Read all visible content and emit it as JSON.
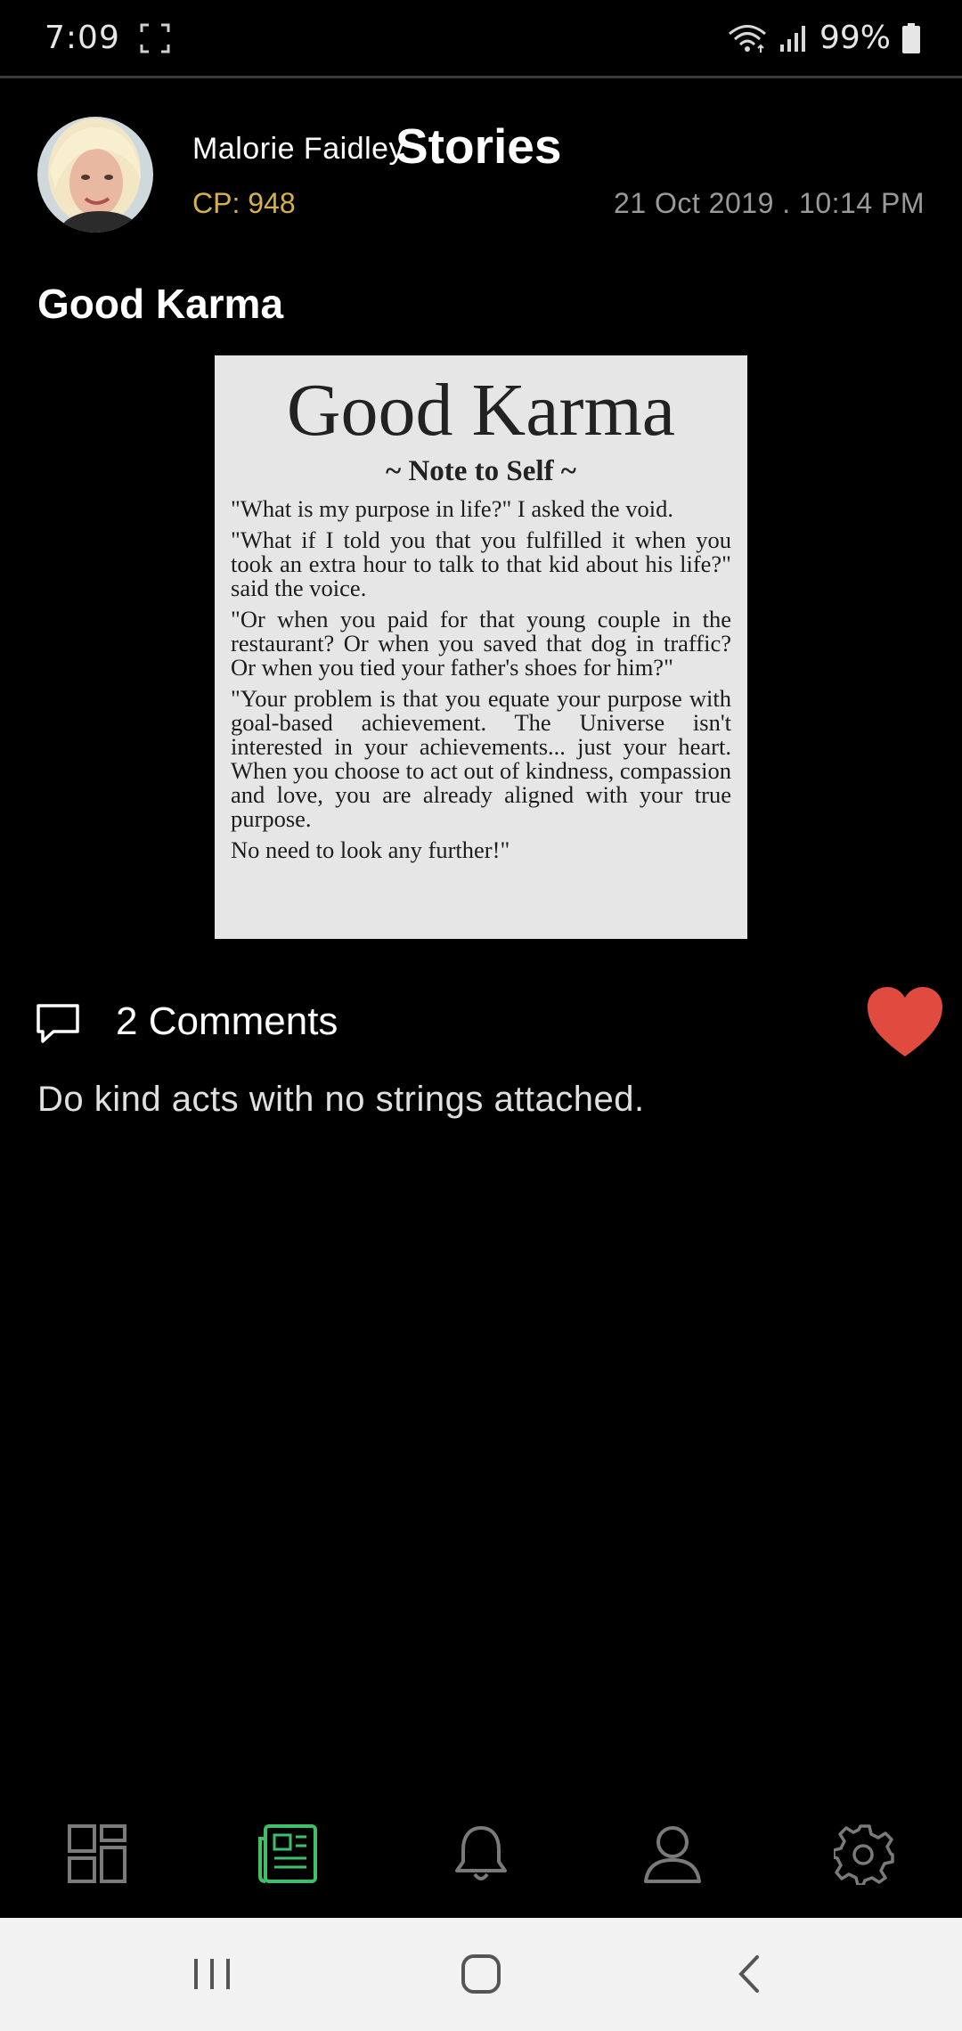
{
  "status_bar": {
    "time": "7:09",
    "battery": "99%"
  },
  "header": {
    "page_title": "Stories",
    "author_name": "Malorie Faidley",
    "author_cp": "CP: 948",
    "post_date": "21 Oct 2019 . 10:14 PM"
  },
  "story": {
    "title": "Good Karma",
    "image_text": {
      "title": "Good Karma",
      "subtitle": "~ Note to Self ~",
      "paragraphs": [
        "\"What is my purpose in life?\" I asked the void.",
        "\"What if I told you that you fulfilled it when you took an extra hour to talk to that kid about his life?\" said the voice.",
        "\"Or when you paid for that young couple in the restaurant? Or when you saved that dog in traffic? Or when you tied your father's shoes for him?\"",
        "\"Your problem is that you equate your purpose with goal-based achievement. The Universe isn't interested in your achievements... just your heart. When you choose to act out of kindness, compassion and love, you are already aligned with your true purpose.",
        "No need to look any further!\""
      ]
    },
    "comments_label": "2 Comments",
    "caption": "Do kind acts with no strings attached."
  },
  "bottom_nav": {
    "items": [
      {
        "icon": "dashboard-icon",
        "active": false
      },
      {
        "icon": "stories-icon",
        "active": true
      },
      {
        "icon": "bell-icon",
        "active": false
      },
      {
        "icon": "profile-icon",
        "active": false
      },
      {
        "icon": "gear-icon",
        "active": false
      }
    ]
  },
  "colors": {
    "background": "#000000",
    "accent_green": "#3fbf6a",
    "cp_gold": "#d6b04a",
    "like_red": "#e04a3f",
    "nav_icon_gray": "#7a7a7a"
  }
}
